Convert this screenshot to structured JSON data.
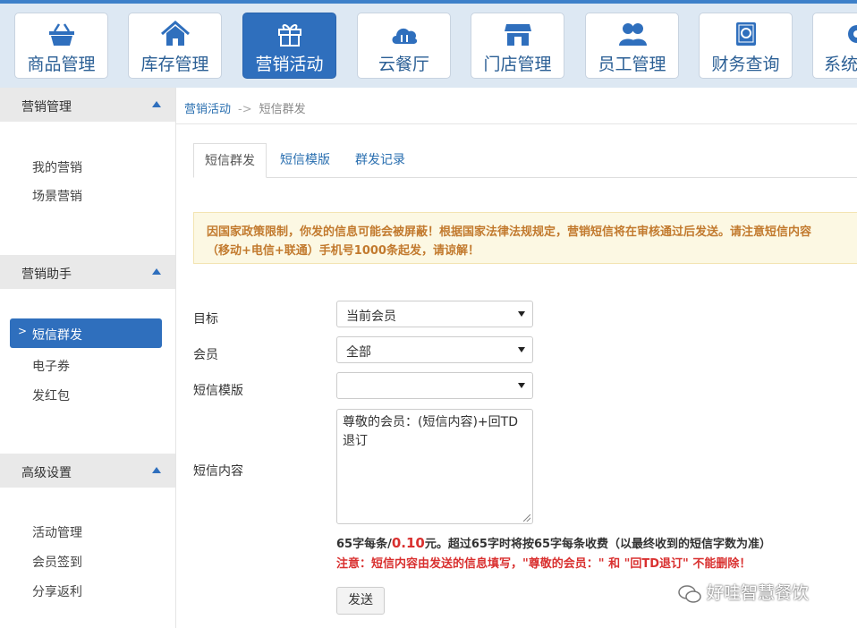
{
  "topnav": {
    "items": [
      {
        "label": "商品管理",
        "icon": "basket-icon"
      },
      {
        "label": "库存管理",
        "icon": "house-icon"
      },
      {
        "label": "营销活动",
        "icon": "gift-icon",
        "active": true
      },
      {
        "label": "云餐厅",
        "icon": "cloud-dining-icon"
      },
      {
        "label": "门店管理",
        "icon": "storefront-icon"
      },
      {
        "label": "员工管理",
        "icon": "users-icon"
      },
      {
        "label": "财务查询",
        "icon": "safe-icon"
      },
      {
        "label": "系统",
        "icon": "gear-icon"
      }
    ],
    "accent": "#2f6fbd"
  },
  "sidebar": {
    "sections": [
      {
        "title": "营销管理",
        "items": [
          "我的营销",
          "场景营销"
        ]
      },
      {
        "title": "营销助手",
        "items": [
          "短信群发",
          "电子券",
          "发红包"
        ],
        "active": "短信群发"
      },
      {
        "title": "高级设置",
        "items": [
          "活动管理",
          "会员签到",
          "分享返利"
        ]
      }
    ]
  },
  "breadcrumb": {
    "parent": "营销活动",
    "separator": "->",
    "current": "短信群发"
  },
  "tabs": [
    "短信群发",
    "短信模版",
    "群发记录"
  ],
  "alert": {
    "line1": "因国家政策限制，你发的信息可能会被屏蔽！根据国家法律法规规定，营销短信将在审核通过后发送。请注意短信内容",
    "line2": "（移动+电信+联通）手机号1000条起发，请谅解！"
  },
  "form": {
    "target": {
      "label": "目标",
      "value": "当前会员"
    },
    "member": {
      "label": "会员",
      "value": "全部"
    },
    "template": {
      "label": "短信模版",
      "value": ""
    },
    "content": {
      "label": "短信内容",
      "value": "尊敬的会员：(短信内容)+回TD退订"
    }
  },
  "pricing": {
    "prefix": "65字每条/",
    "price": "0.10",
    "suffix": "元。超过65字时将按65字每条收费（以最终收到的短信字数为准）",
    "note": "注意：短信内容由发送的信息填写，\"尊敬的会员：\" 和 \"回TD退订\" 不能删除！"
  },
  "send_button": "发送",
  "watermark": "好哇智慧餐饮"
}
